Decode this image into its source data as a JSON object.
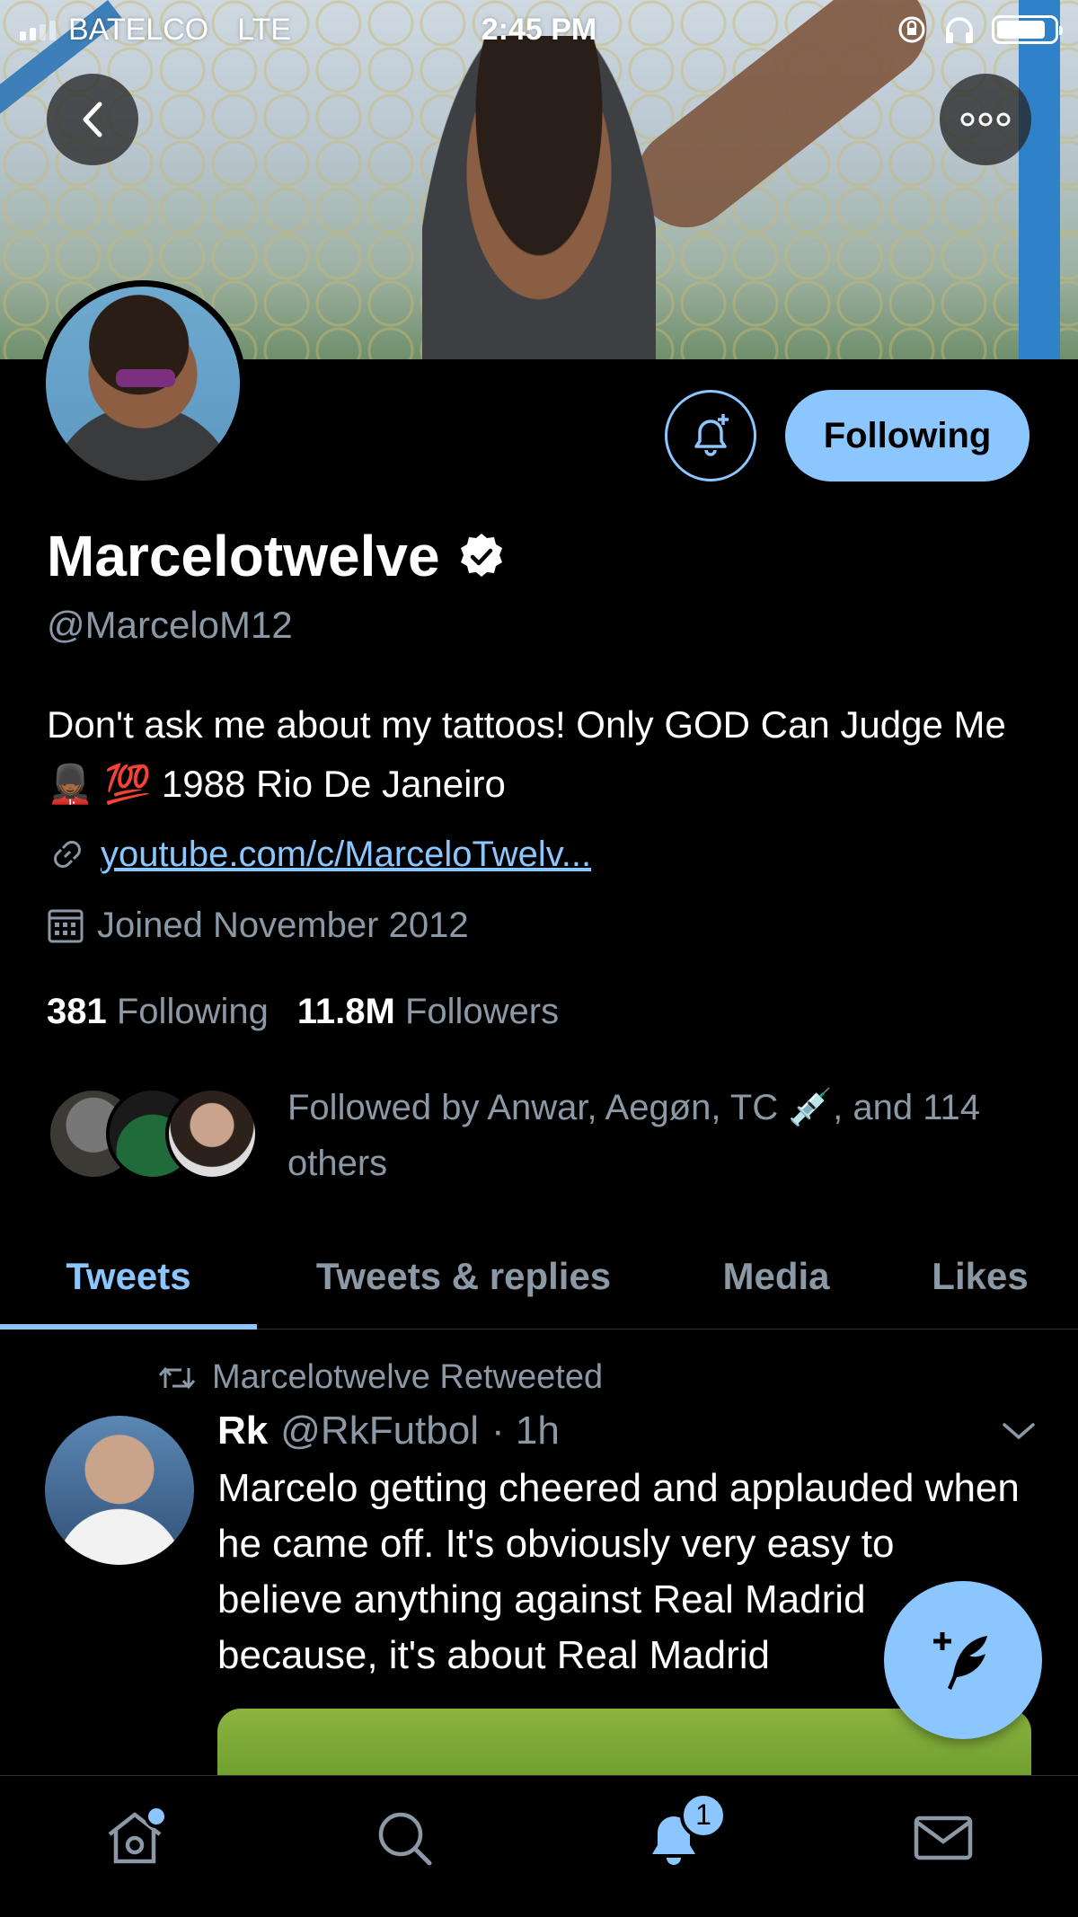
{
  "status_bar": {
    "carrier": "BATELCO",
    "network": "LTE",
    "time": "2:45 PM",
    "battery_level": 0.85
  },
  "profile": {
    "display_name": "Marcelotwelve",
    "verified": true,
    "handle": "@MarceloM12",
    "bio": "Don't ask me about my tattoos! Only GOD Can Judge Me 💂🏾 💯 1988 Rio De Janeiro",
    "link": "youtube.com/c/MarceloTwelv...",
    "joined": "Joined November 2012",
    "following_count": "381",
    "following_label": "Following",
    "followers_count": "11.8M",
    "followers_label": "Followers",
    "followed_by": "Followed by Anwar, Aegøn, TC 💉, and 114 others",
    "follow_button_label": "Following"
  },
  "tabs": [
    {
      "label": "Tweets",
      "active": true
    },
    {
      "label": "Tweets & replies",
      "active": false
    },
    {
      "label": "Media",
      "active": false
    },
    {
      "label": "Likes",
      "active": false
    }
  ],
  "tweet": {
    "retweet_label": "Marcelotwelve Retweeted",
    "author_name": "Rk",
    "author_handle": "@RkFutbol",
    "time": "· 1h",
    "text": "Marcelo getting cheered and applauded when he came off. It's obviously very easy to believe anything against Real Madrid because, it's about Real Madrid"
  },
  "bottom_nav": {
    "notifications_badge": "1"
  },
  "colors": {
    "accent": "#8cc6ff",
    "background": "#000000",
    "secondary_text": "#8b98a5"
  }
}
